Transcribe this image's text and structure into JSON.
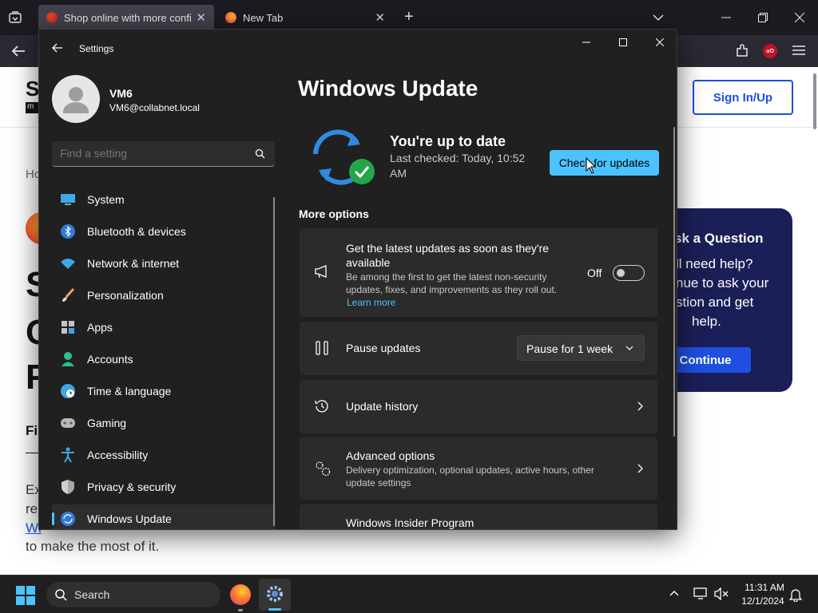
{
  "browser": {
    "tabs": [
      {
        "title": "Shop online with more confide",
        "active": true
      },
      {
        "title": "New Tab",
        "active": false
      }
    ],
    "new_tab_symbol": "+",
    "toolbar_icons": [
      "back-arrow-icon",
      "extensions-icon",
      "ublock-icon",
      "hamburger-menu-icon"
    ],
    "ublock_label": "uO"
  },
  "webpage": {
    "brand_letter": "S",
    "brand_sub": "m",
    "sign_in_label": "Sign In/Up",
    "breadcrumb_fragment": "Ho",
    "heading_fragments": [
      "S",
      "C",
      "F"
    ],
    "subhead_fragment": "Fi",
    "paragraph_line1": "Ex",
    "paragraph_line2": "re",
    "link_fragment": "Wi",
    "paragraph_last": "to make the most of it.",
    "question_card": {
      "title": "sk a Question",
      "lines": [
        "ll need help?",
        "nue to ask your",
        "stion and get",
        "help."
      ],
      "continue_label": "Continue",
      "bg_color": "#1b1f57",
      "button_color": "#1f4fe0"
    }
  },
  "settings": {
    "window_title": "Settings",
    "user": {
      "name": "VM6",
      "email": "VM6@collabnet.local"
    },
    "search_placeholder": "Find a setting",
    "nav_items": [
      {
        "label": "System",
        "icon": "system-monitor-icon"
      },
      {
        "label": "Bluetooth & devices",
        "icon": "bluetooth-icon"
      },
      {
        "label": "Network & internet",
        "icon": "wifi-icon"
      },
      {
        "label": "Personalization",
        "icon": "paintbrush-icon"
      },
      {
        "label": "Apps",
        "icon": "apps-icon"
      },
      {
        "label": "Accounts",
        "icon": "accounts-icon"
      },
      {
        "label": "Time & language",
        "icon": "globe-clock-icon"
      },
      {
        "label": "Gaming",
        "icon": "gamepad-icon"
      },
      {
        "label": "Accessibility",
        "icon": "accessibility-icon"
      },
      {
        "label": "Privacy & security",
        "icon": "shield-icon"
      },
      {
        "label": "Windows Update",
        "icon": "windows-update-icon",
        "selected": true
      }
    ],
    "page_title": "Windows Update",
    "status": {
      "title": "You're up to date",
      "last_checked": "Last checked: Today, 10:52 AM",
      "check_button": "Check for updates"
    },
    "more_options_label": "More options",
    "latest_updates": {
      "title": "Get the latest updates as soon as they're available",
      "description": "Be among the first to get the latest non-security updates, fixes, and improvements as they roll out.",
      "learn_more": "Learn more",
      "toggle_label": "Off",
      "toggle_on": false
    },
    "pause_updates": {
      "title": "Pause updates",
      "dropdown_value": "Pause for 1 week"
    },
    "update_history": {
      "title": "Update history"
    },
    "advanced_options": {
      "title": "Advanced options",
      "description": "Delivery optimization, optional updates, active hours, other update settings"
    },
    "insider_program": {
      "title": "Windows Insider Program"
    },
    "accent_color": "#4cc2ff",
    "button_color": "#4cc2ff"
  },
  "taskbar": {
    "search_placeholder": "Search",
    "pinned": [
      "firefox-icon",
      "settings-gear-icon"
    ],
    "time": "11:31 AM",
    "date": "12/1/2024",
    "tray_icons": [
      "chevron-up-icon",
      "network-icon",
      "volume-muted-icon",
      "notifications-bell-icon"
    ]
  }
}
